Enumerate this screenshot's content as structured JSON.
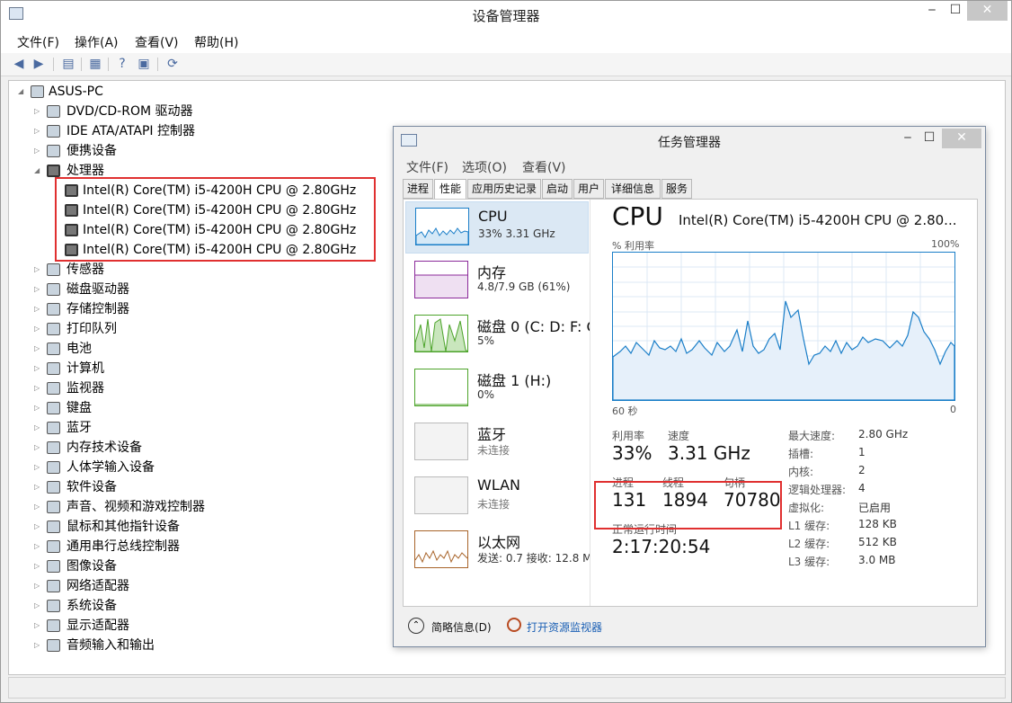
{
  "window": {
    "title": "设备管理器",
    "min": "‒",
    "max": "☐",
    "close": "✕"
  },
  "menu": [
    "文件(F)",
    "操作(A)",
    "查看(V)",
    "帮助(H)"
  ],
  "tree": {
    "root": "ASUS-PC",
    "items": [
      "DVD/CD-ROM 驱动器",
      "IDE ATA/ATAPI 控制器",
      "便携设备",
      "处理器",
      "Intel(R) Core(TM) i5-4200H CPU @ 2.80GHz",
      "Intel(R) Core(TM) i5-4200H CPU @ 2.80GHz",
      "Intel(R) Core(TM) i5-4200H CPU @ 2.80GHz",
      "Intel(R) Core(TM) i5-4200H CPU @ 2.80GHz",
      "传感器",
      "磁盘驱动器",
      "存储控制器",
      "打印队列",
      "电池",
      "计算机",
      "监视器",
      "键盘",
      "蓝牙",
      "内存技术设备",
      "人体学输入设备",
      "软件设备",
      "声音、视频和游戏控制器",
      "鼠标和其他指针设备",
      "通用串行总线控制器",
      "图像设备",
      "网络适配器",
      "系统设备",
      "显示适配器",
      "音频输入和输出"
    ]
  },
  "tm": {
    "title": "任务管理器",
    "menu": [
      "文件(F)",
      "选项(O)",
      "查看(V)"
    ],
    "tabs": [
      "进程",
      "性能",
      "应用历史记录",
      "启动",
      "用户",
      "详细信息",
      "服务"
    ],
    "side": [
      {
        "name": "CPU",
        "sub": "33% 3.31 GHz"
      },
      {
        "name": "内存",
        "sub": "4.8/7.9 GB (61%)"
      },
      {
        "name": "磁盘 0 (C: D: F: G",
        "sub": "5%"
      },
      {
        "name": "磁盘 1 (H:)",
        "sub": "0%"
      },
      {
        "name": "蓝牙",
        "sub": "未连接"
      },
      {
        "name": "WLAN",
        "sub": "未连接"
      },
      {
        "name": "以太网",
        "sub": "发送: 0.7  接收: 12.8 M"
      }
    ],
    "cpu_title": "CPU",
    "cpu_model": "Intel(R) Core(TM) i5-4200H CPU @ 2.80...",
    "util_label": "% 利用率",
    "pct100": "100%",
    "sixty": "60 秒",
    "zero": "0",
    "stats": {
      "util_l": "利用率",
      "util_v": "33%",
      "speed_l": "速度",
      "speed_v": "3.31 GHz",
      "proc_l": "进程",
      "proc_v": "131",
      "thr_l": "线程",
      "thr_v": "1894",
      "hdl_l": "句柄",
      "hdl_v": "70780",
      "up_l": "正常运行时间",
      "up_v": "2:17:20:54"
    },
    "specs": [
      {
        "k": "最大速度:",
        "v": "2.80 GHz"
      },
      {
        "k": "插槽:",
        "v": "1"
      },
      {
        "k": "内核:",
        "v": "2"
      },
      {
        "k": "逻辑处理器:",
        "v": "4"
      },
      {
        "k": "虚拟化:",
        "v": "已启用"
      },
      {
        "k": "L1 缓存:",
        "v": "128 KB"
      },
      {
        "k": "L2 缓存:",
        "v": "512 KB"
      },
      {
        "k": "L3 缓存:",
        "v": "3.0 MB"
      }
    ],
    "fewer": "简略信息(D)",
    "monitor": "打开资源监视器"
  }
}
